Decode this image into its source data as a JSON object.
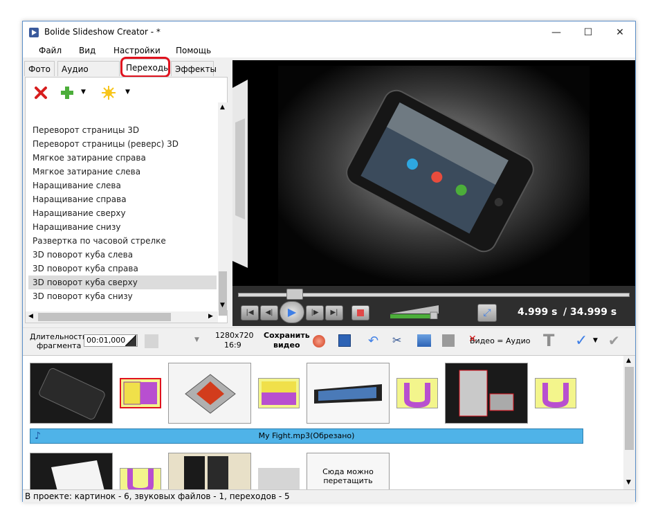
{
  "window": {
    "title": "Bolide Slideshow Creator - *",
    "minimize": "—",
    "maximize": "☐",
    "close": "✕"
  },
  "menu": [
    "Файл",
    "Вид",
    "Настройки",
    "Помощь"
  ],
  "tabs": [
    "Фото",
    "Аудио файлы",
    "Переходы",
    "Эффекты"
  ],
  "active_tab": "Переходы",
  "transitions": [
    "Переворот страницы 3D",
    "Переворот страницы (реверс) 3D",
    "Мягкое затирание справа",
    "Мягкое затирание слева",
    "Наращивание слева",
    "Наращивание справа",
    "Наращивание сверху",
    "Наращивание снизу",
    "Развертка по часовой стрелке",
    "3D поворот куба слева",
    "3D поворот куба справа",
    "3D поворот куба сверху",
    "3D поворот куба снизу"
  ],
  "selected_transition": "3D поворот куба сверху",
  "player": {
    "current_time": "4.999 s",
    "total_time": "/ 34.999 s",
    "progress": 0.143
  },
  "bottom": {
    "duration_label_1": "Длительность",
    "duration_label_2": "фрагмента",
    "duration_value": "00:01,000",
    "resolution": "1280x720",
    "aspect": "16:9",
    "save_label_1": "Сохранить",
    "save_label_2": "видео",
    "video_audio": "Видео = Аудио"
  },
  "storyboard": {
    "audio_track": "My Fight.mp3(Обрезано)",
    "drop_hint_1": "Сюда можно",
    "drop_hint_2": "перетащить"
  },
  "status": "В проекте: картинок - 6, звуковых файлов - 1, переходов - 5",
  "colors": {
    "accent": "#3f7fe6",
    "highlight": "#e0121e",
    "audio": "#4fb3e8"
  }
}
